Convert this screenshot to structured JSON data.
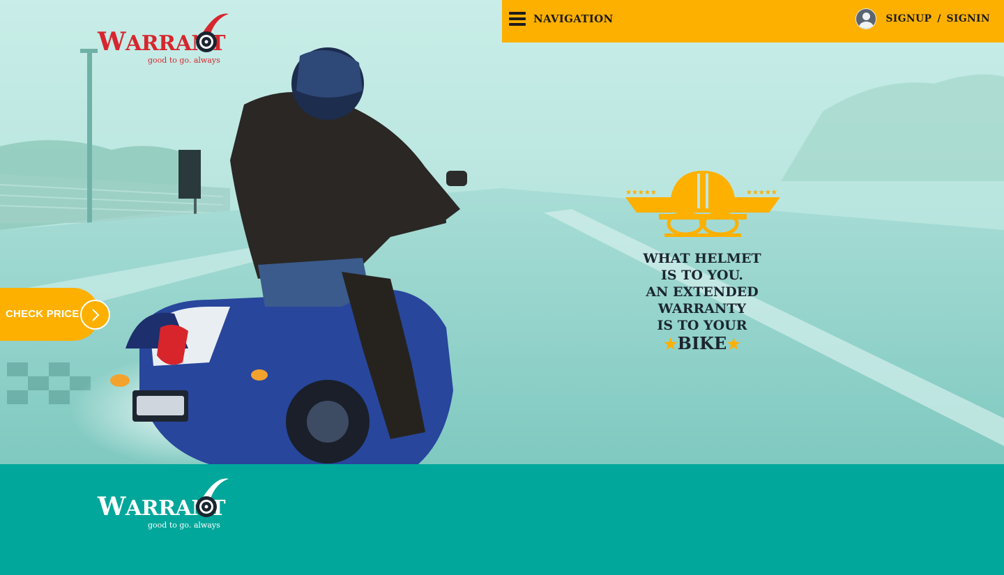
{
  "brand": {
    "name_first": "W",
    "name_rest": "ARRANT",
    "tagline": "good to go. always",
    "accent_color": "#fdb000",
    "logo_red": "#d7262e",
    "footer_color": "#00a79a"
  },
  "nav": {
    "label": "NAVIGATION",
    "icon": "hamburger-icon"
  },
  "account": {
    "avatar_icon": "user-avatar-icon",
    "signup": "SIGNUP",
    "separator": "/",
    "signin": "SIGNIN"
  },
  "hero": {
    "cta_label": "CHECK PRICE",
    "cta_icon": "chevron-right-icon",
    "emblem_icon": "winged-helmet-goggles-icon",
    "tagline_lines": [
      "WHAT HELMET",
      "IS TO YOU.",
      "AN EXTENDED",
      "WARRANTY",
      "IS TO YOUR"
    ],
    "tagline_last": "BIKE",
    "star_icon": "star-icon"
  }
}
